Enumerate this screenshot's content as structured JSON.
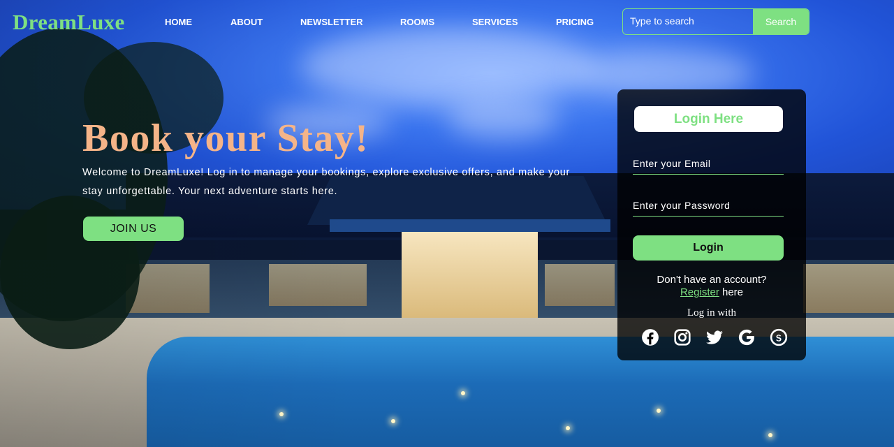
{
  "brand": {
    "name": "DreamLuxe",
    "accent": "#7ee082"
  },
  "nav": {
    "items": [
      {
        "label": "HOME"
      },
      {
        "label": "ABOUT"
      },
      {
        "label": "NEWSLETTER"
      },
      {
        "label": "ROOMS"
      },
      {
        "label": "SERVICES"
      },
      {
        "label": "PRICING"
      }
    ]
  },
  "search": {
    "placeholder": "Type to search",
    "button_label": "Search"
  },
  "hero": {
    "title": "Book your Stay!",
    "text": "Welcome to DreamLuxe! Log in to manage your bookings, explore exclusive offers, and make your stay unforgettable. Your next adventure starts here.",
    "cta_label": "JOIN US",
    "title_color": "#f5b488"
  },
  "login": {
    "header": "Login Here",
    "email_placeholder": "Enter your Email",
    "password_placeholder": "Enter your Password",
    "button_label": "Login",
    "signup_prompt": "Don't have an account?",
    "register_link": "Register",
    "register_suffix": " here",
    "login_with": "Log in with",
    "socials": [
      "facebook-icon",
      "instagram-icon",
      "twitter-icon",
      "google-icon",
      "skype-icon"
    ]
  }
}
